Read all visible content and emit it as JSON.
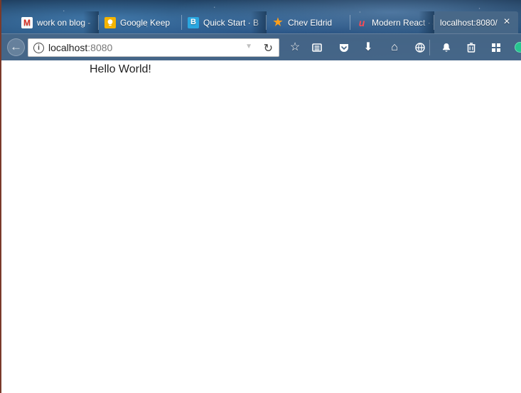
{
  "tabs": [
    {
      "label": "work on blog - ",
      "icon": "gmail-icon"
    },
    {
      "label": "Google Keep",
      "icon": "google-keep-icon"
    },
    {
      "label": "Quick Start · B",
      "icon": "bootstrap-icon"
    },
    {
      "label": "Chev Eldrid",
      "icon": "star-icon"
    },
    {
      "label": "Modern React ·",
      "icon": "udemy-icon"
    },
    {
      "label": "localhost:8080/",
      "icon": "none"
    }
  ],
  "tab_close": "×",
  "address_bar": {
    "host": "localhost",
    "port": ":8080"
  },
  "toolbar_icons": [
    "bookmark-star-icon",
    "reader-list-icon",
    "pocket-icon",
    "download-icon",
    "home-icon",
    "synced-tabs-icon",
    "extension-bell-icon",
    "trash-icon",
    "grid-icon",
    "green-extension-icon"
  ],
  "page": {
    "heading": "Hello World!"
  }
}
